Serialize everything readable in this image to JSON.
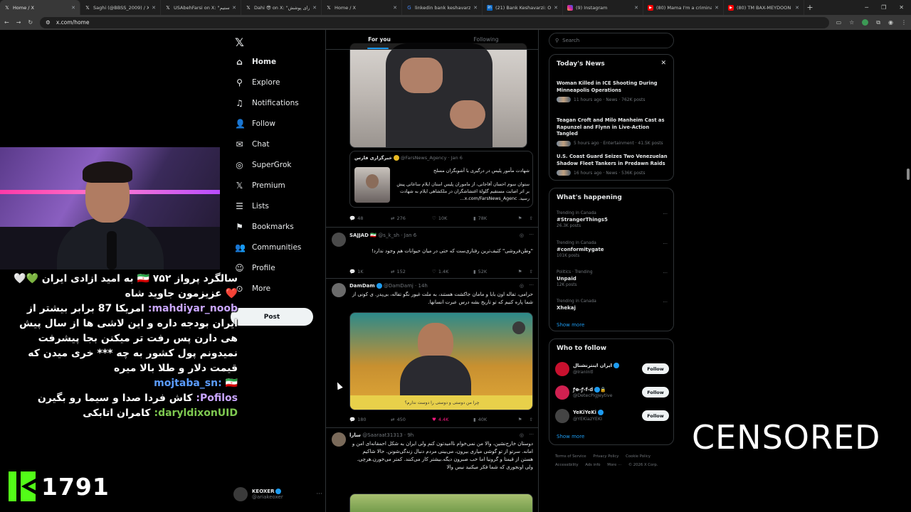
{
  "browser": {
    "tabs": [
      {
        "title": "Home / X",
        "icon": "x-logo-icon",
        "active": true
      },
      {
        "title": "Saghi (@BBSS_2009) / X",
        "icon": "x-logo-icon"
      },
      {
        "title": "USAbehFarsi on X: \"ما هستیم",
        "icon": "x-logo-icon"
      },
      {
        "title": "Dahi 😎 on X: \"برای پوشش",
        "icon": "x-logo-icon"
      },
      {
        "title": "Home / X",
        "icon": "x-logo-icon"
      },
      {
        "title": "linkedin bank keshavarzi - Go",
        "icon": "google-icon"
      },
      {
        "title": "(21) Bank Keshavarzi: Overvie",
        "icon": "linkedin-icon"
      },
      {
        "title": "(9) Instagram",
        "icon": "instagram-icon"
      },
      {
        "title": "(80) Mama I'm a criminal [OFF",
        "icon": "youtube-icon"
      },
      {
        "title": "(80) TM BAX-MEYDOON OFFI",
        "icon": "youtube-icon"
      }
    ],
    "url": "x.com/home"
  },
  "stream": {
    "chat": [
      {
        "user": "",
        "message": "سالگرد پرواز ۷۵۲ 🇮🇷 به امید ازادی ایران 💚🤍❤️ عزیزمون جاوید شاه",
        "user_color": "#ffffff"
      },
      {
        "user": "mahdiyar_noob:",
        "message": "امریکا 87 برابر بیشتر از ایران بودجه داره و این لاشی ها از سال پیش هی دارن پس رفت تر میکنن بجا پیشرفت نمیدونم پول کشور به چه *** خری میدن که قیمت دلار و طلا بالا میره",
        "user_color": "#c9a6ff"
      },
      {
        "user": "mojtaba_sn:",
        "message": "🇮🇷",
        "user_color": "#5b9cff"
      },
      {
        "user": "Pofilos:",
        "message": "کاش فردا صدا و سیما رو بگیرن",
        "user_color": "#c9a6ff"
      },
      {
        "user": "daryldixonUID:",
        "message": "کامران اتابکی",
        "user_color": "#7ec850"
      }
    ],
    "count": "1791",
    "censored_label": "CENSORED"
  },
  "nav": {
    "items": [
      {
        "label": "Home",
        "icon": "home-icon",
        "current": true
      },
      {
        "label": "Explore",
        "icon": "search-icon"
      },
      {
        "label": "Notifications",
        "icon": "bell-icon"
      },
      {
        "label": "Follow",
        "icon": "follow-icon"
      },
      {
        "label": "Chat",
        "icon": "chat-icon"
      },
      {
        "label": "SuperGrok",
        "icon": "grok-icon"
      },
      {
        "label": "Premium",
        "icon": "x-logo-icon"
      },
      {
        "label": "Lists",
        "icon": "list-icon"
      },
      {
        "label": "Bookmarks",
        "icon": "bookmark-icon"
      },
      {
        "label": "Communities",
        "icon": "communities-icon"
      },
      {
        "label": "Profile",
        "icon": "profile-icon"
      },
      {
        "label": "More",
        "icon": "more-icon"
      }
    ],
    "post_label": "Post",
    "account": {
      "name": "KEOXER",
      "handle": "@ariakeoxer"
    }
  },
  "feed": {
    "tabs": [
      "For you",
      "Following"
    ],
    "quote": {
      "name": "خبرگزاری فارس",
      "handle": "@FarsNews_Agency · Jan 6",
      "line1": "شهادت مأمور پلیس در درگیری با آشوبگران مسلح",
      "line2": "ستوان سوم احسان آقاجانی، از ماموران پلیس استان ایلام ساعاتی پیش بر اثر اصابت مستقیم گلولهٔ اغتشاشگران در ملکشاهی ایلام به شهادت رسید. x.com/FarsNews_Agenc..."
    },
    "tweet1_actions": [
      "48",
      "276",
      "10K",
      "78K"
    ],
    "tweets": [
      {
        "name": "SAJJAD 🇮🇷",
        "meta": "@s_k_sh · Jan 6",
        "text": "\"وطن‌فروشی\" کثیف‌ترین رفتاری‌ست که حتی در میان حیوانات هم وجود ندارد!",
        "actions": [
          "1K",
          "152",
          "1.4K",
          "52K"
        ]
      },
      {
        "name": "DamDam",
        "meta": "@DamDamj · 14h",
        "text": "حرامی، تفاله اون بابا و مامان جاکشت هستند، به ملت غیور نگو تفاله، بی‌پدر. ی کونی از شما پاره کنیم که تو تاریخ بشه درس عبرت انسانها.",
        "media_caption": "چرا من دوستی و دوستی را دوست ندارم؟",
        "actions": [
          "180",
          "450",
          "4.4K",
          "40K"
        ]
      },
      {
        "name": "سارا",
        "meta": "@Saaraat31313 · 9h",
        "text": "دوستان خارج‌نشین، والا من نمی‌خوام ناامیدتون کنم ولی ایران به شکل احمقانه‌ای امن و امانه. سرتو از تو گوشی میاری بیرون، می‌بینی مردم دنبال زندگی‌شونن. حالا شاکیم هستن از قیمتا و گرونیا اما خب صبرون دیگه.بیشتر کار می‌کنند. کمتر می‌خورن.هرچی. ولی اونجوری که شما فکر میکنید نیس والا"
      }
    ]
  },
  "right": {
    "search_placeholder": "Search",
    "todays_news": {
      "title": "Today's News",
      "items": [
        {
          "title": "Woman Killed in ICE Shooting During Minneapolis Operations",
          "meta": "11 hours ago · News · 762K posts"
        },
        {
          "title": "Teagan Croft and Milo Manheim Cast as Rapunzel and Flynn in Live-Action Tangled",
          "meta": "5 hours ago · Entertainment · 41.5K posts"
        },
        {
          "title": "U.S. Coast Guard Seizes Two Venezuelan Shadow Fleet Tankers in Predawn Raids",
          "meta": "16 hours ago · News · 536K posts"
        }
      ]
    },
    "whats_happening": {
      "title": "What's happening",
      "items": [
        {
          "context": "Trending in Canada",
          "name": "#StrangerThings5",
          "posts": "26.3K posts"
        },
        {
          "context": "Trending in Canada",
          "name": "#conformitygate",
          "posts": "101K posts"
        },
        {
          "context": "Politics · Trending",
          "name": "Unpaid",
          "posts": "12K posts"
        },
        {
          "context": "Trending in Canada",
          "name": "Xhekaj",
          "posts": ""
        }
      ],
      "show_more": "Show more"
    },
    "who_to_follow": {
      "title": "Who to follow",
      "items": [
        {
          "name": "ایران اینترنشنال",
          "handle": "@IranIntl",
          "button": "Follow"
        },
        {
          "name": "ꝭꝋ-ꝭ-f-d",
          "handle": "@DetecPigJeytive",
          "button": "Follow"
        },
        {
          "name": "YeKiYeKi",
          "handle": "@YEKiazYEKI",
          "button": "Follow"
        }
      ],
      "show_more": "Show more"
    },
    "footer": [
      "Terms of Service",
      "Privacy Policy",
      "Cookie Policy",
      "Accessibility",
      "Ads info",
      "More ···",
      "© 2026 X Corp."
    ]
  }
}
